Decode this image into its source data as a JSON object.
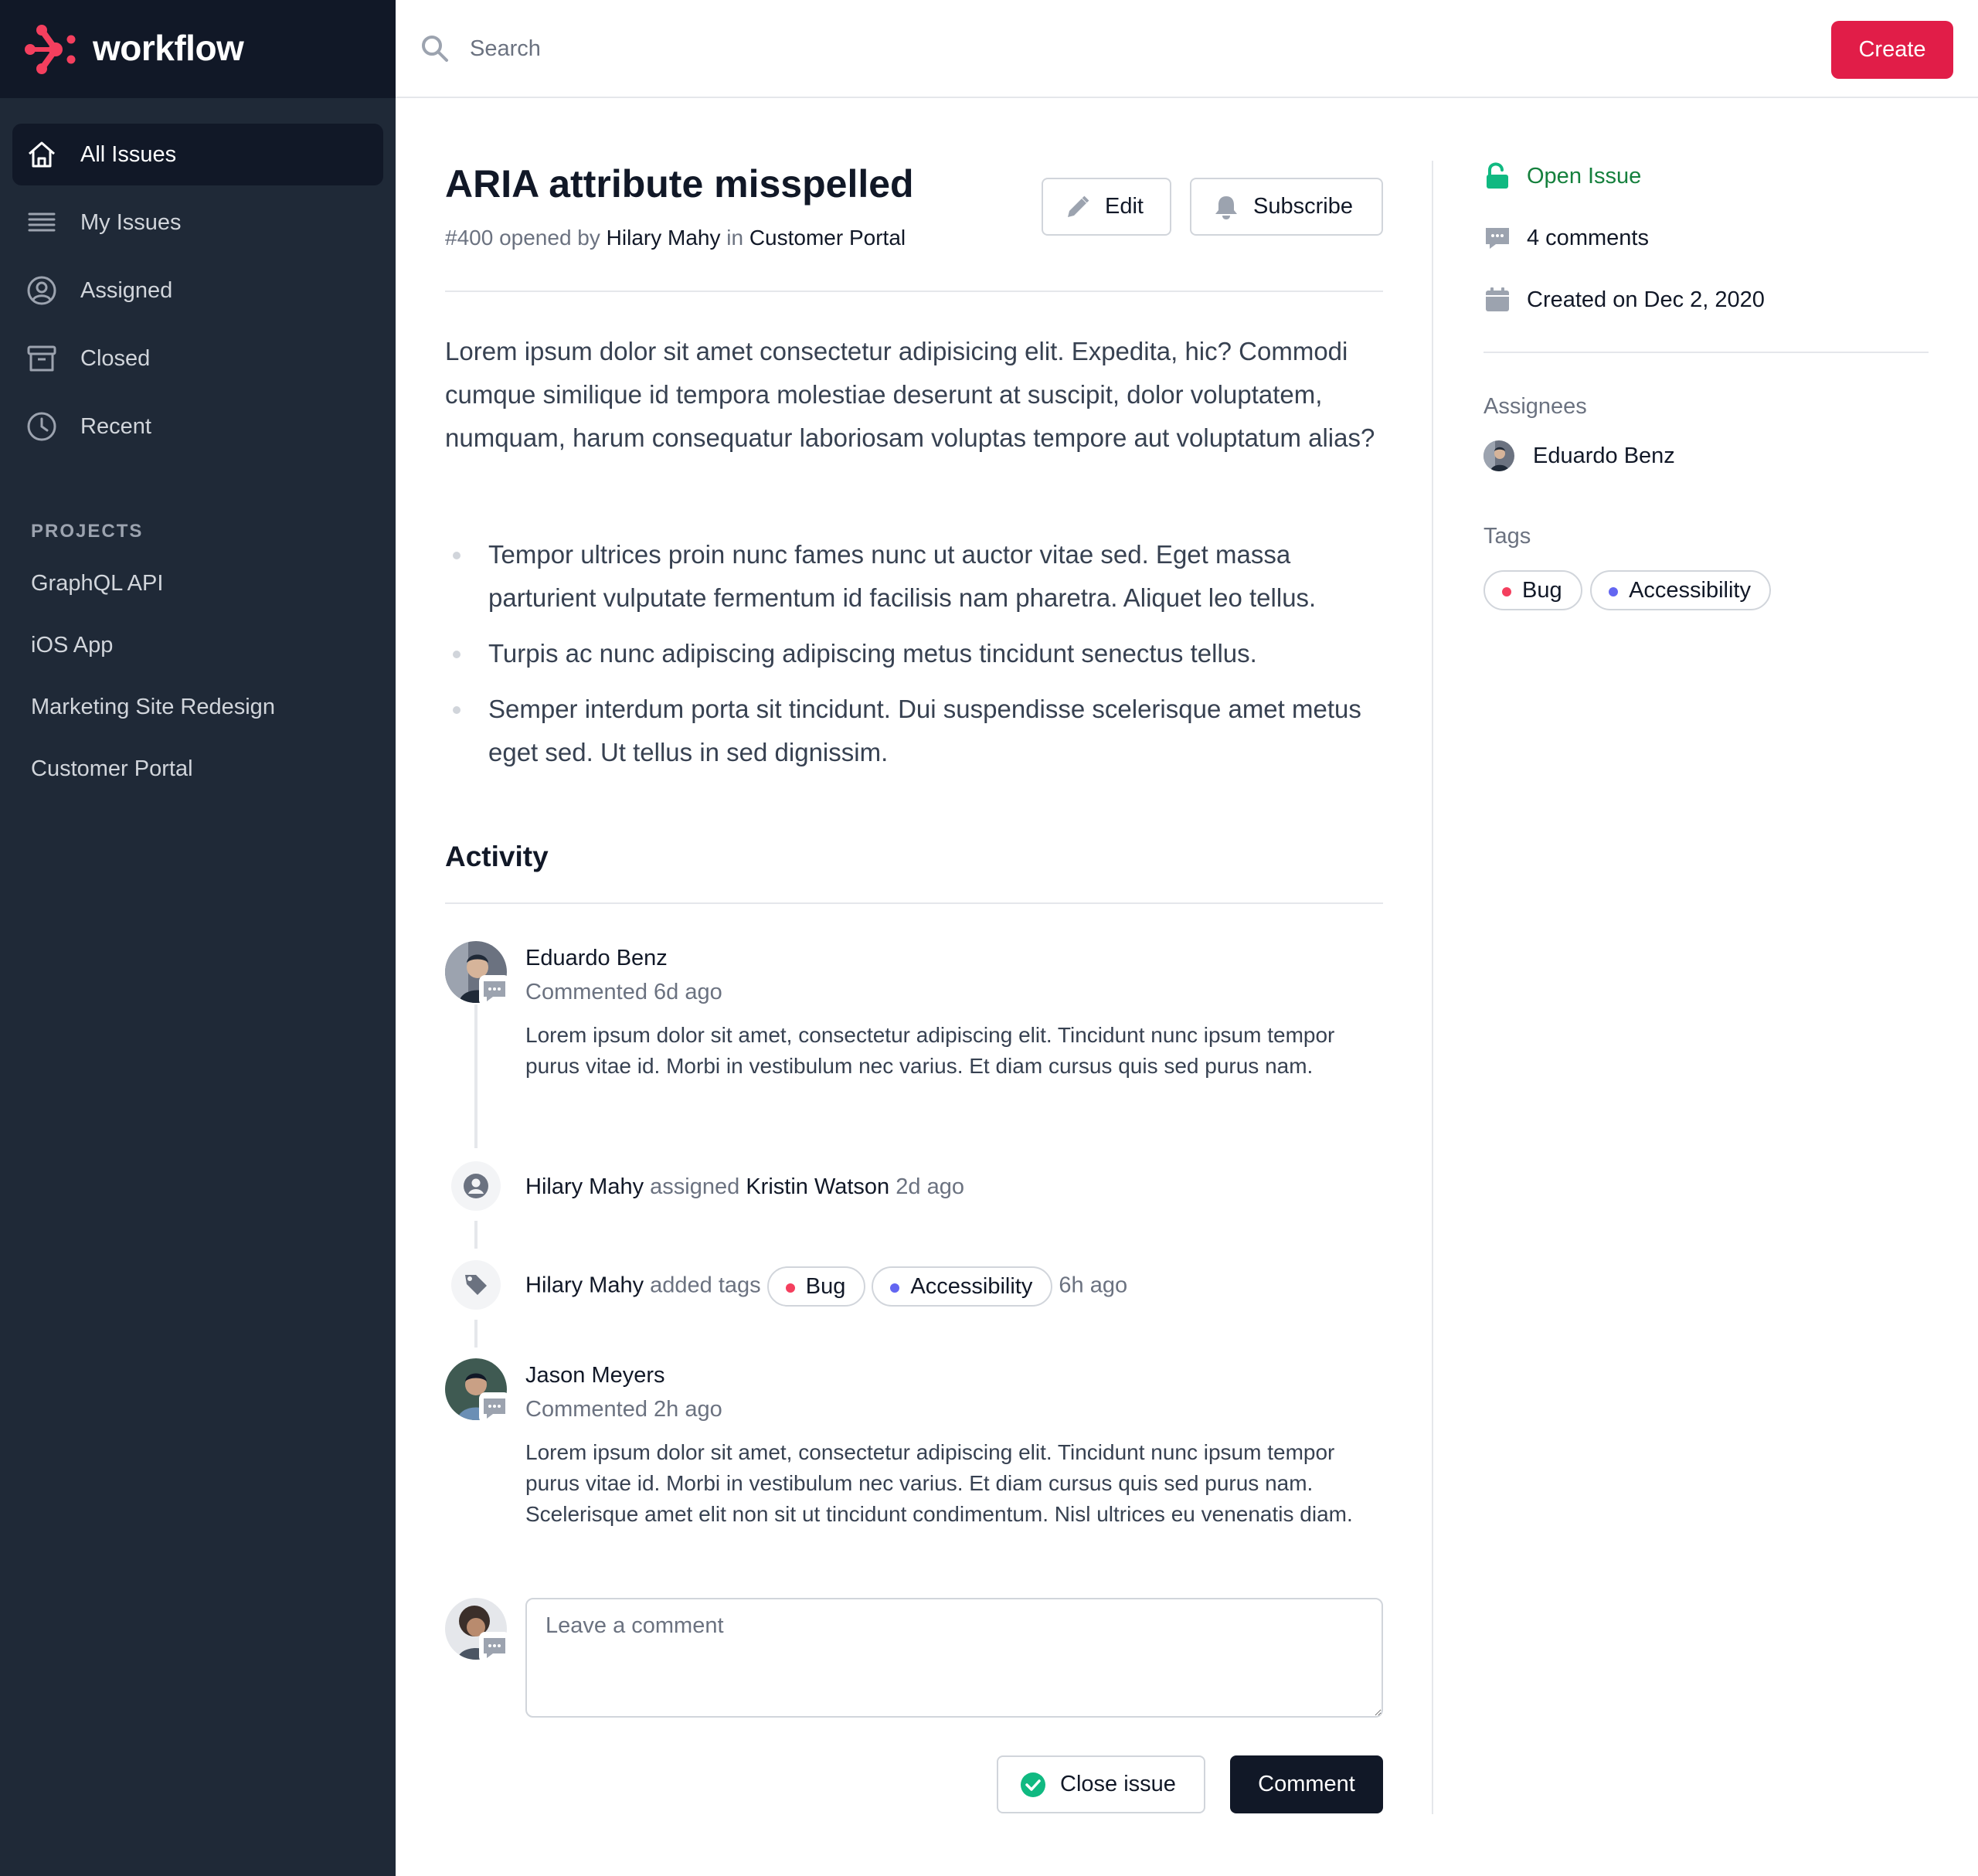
{
  "app": {
    "name": "workflow",
    "accent": "#e11d48",
    "sidebar_bg": "#1f2937"
  },
  "nav": {
    "items": [
      {
        "label": "All Issues",
        "icon": "home-icon",
        "active": true
      },
      {
        "label": "My Issues",
        "icon": "list-icon",
        "active": false
      },
      {
        "label": "Assigned",
        "icon": "user-circle-icon",
        "active": false
      },
      {
        "label": "Closed",
        "icon": "archive-icon",
        "active": false
      },
      {
        "label": "Recent",
        "icon": "clock-icon",
        "active": false
      }
    ]
  },
  "projects": {
    "heading": "PROJECTS",
    "items": [
      "GraphQL API",
      "iOS App",
      "Marketing Site Redesign",
      "Customer Portal"
    ]
  },
  "topbar": {
    "search_placeholder": "Search",
    "create_label": "Create"
  },
  "issue": {
    "title": "ARIA attribute misspelled",
    "number": "#400",
    "opened_by_text": "opened by",
    "author": "Hilary Mahy",
    "in_text": "in",
    "project": "Customer Portal",
    "edit_label": "Edit",
    "subscribe_label": "Subscribe",
    "description": "Lorem ipsum dolor sit amet consectetur adipisicing elit. Expedita, hic? Commodi cumque similique id tempora molestiae deserunt at suscipit, dolor voluptatem, numquam, harum consequatur laboriosam voluptas tempore aut voluptatum alias?",
    "bullets": [
      "Tempor ultrices proin nunc fames nunc ut auctor vitae sed. Eget massa parturient vulputate fermentum id facilisis nam pharetra. Aliquet leo tellus.",
      "Turpis ac nunc adipiscing adipiscing metus tincidunt senectus tellus.",
      "Semper interdum porta sit tincidunt. Dui suspendisse scelerisque amet metus eget sed. Ut tellus in sed dignissim."
    ]
  },
  "activity": {
    "heading": "Activity",
    "comment1": {
      "author": "Eduardo Benz",
      "time": "Commented 6d ago",
      "body": "Lorem ipsum dolor sit amet, consectetur adipiscing elit. Tincidunt nunc ipsum tempor purus vitae id. Morbi in vestibulum nec varius. Et diam cursus quis sed purus nam."
    },
    "assign_event": {
      "actor": "Hilary Mahy",
      "verb": "assigned",
      "target": "Kristin Watson",
      "time": "2d ago"
    },
    "tags_event": {
      "actor": "Hilary Mahy",
      "verb": "added tags",
      "tag1": "Bug",
      "tag2": "Accessibility",
      "time": "6h ago"
    },
    "comment2": {
      "author": "Jason Meyers",
      "time": "Commented 2h ago",
      "body": "Lorem ipsum dolor sit amet, consectetur adipiscing elit. Tincidunt nunc ipsum tempor purus vitae id. Morbi in vestibulum nec varius. Et diam cursus quis sed purus nam. Scelerisque amet elit non sit ut tincidunt condimentum. Nisl ultrices eu venenatis diam."
    },
    "comment_placeholder": "Leave a comment",
    "close_issue_label": "Close issue",
    "comment_button_label": "Comment"
  },
  "side": {
    "status": "Open Issue",
    "status_color": "#15803d",
    "comments_count": "4 comments",
    "created": "Created on Dec 2, 2020",
    "assignees_label": "Assignees",
    "assignee": "Eduardo Benz",
    "tags_label": "Tags",
    "tag1": "Bug",
    "tag1_color": "#f43f5e",
    "tag2": "Accessibility",
    "tag2_color": "#6366f1"
  }
}
